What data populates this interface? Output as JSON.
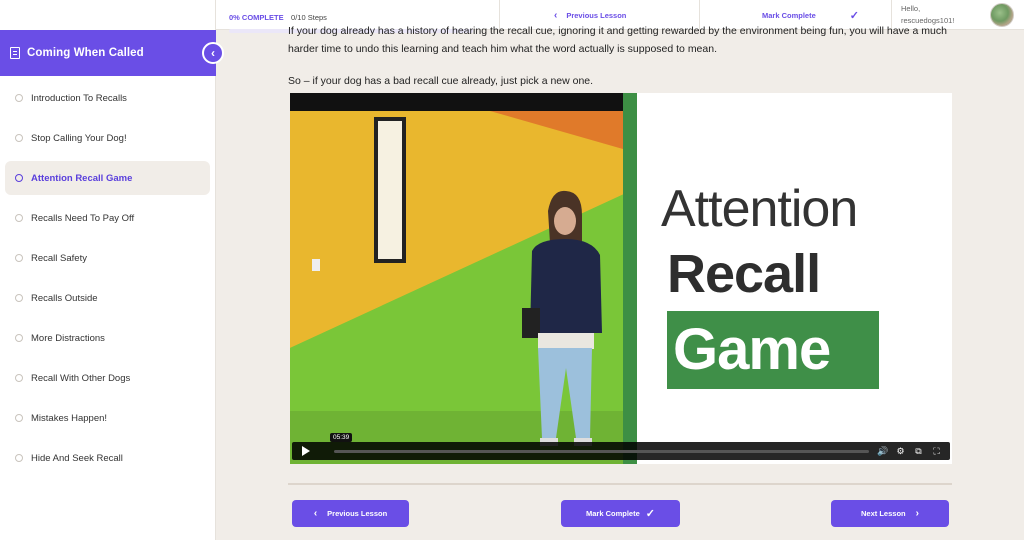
{
  "topbar": {
    "progress_percent": "0% COMPLETE",
    "progress_steps": "0/10 Steps",
    "progress_fraction": 0,
    "previous_label": "Previous Lesson",
    "mark_complete_label": "Mark Complete",
    "hello_line1": "Hello,",
    "hello_line2": "rescuedogs101!"
  },
  "sidebar": {
    "course_title": "Coming When Called",
    "lessons": [
      {
        "label": "Introduction To Recalls"
      },
      {
        "label": "Stop Calling Your Dog!"
      },
      {
        "label": "Attention Recall Game",
        "active": true
      },
      {
        "label": "Recalls Need To Pay Off"
      },
      {
        "label": "Recall Safety"
      },
      {
        "label": "Recalls Outside"
      },
      {
        "label": "More Distractions"
      },
      {
        "label": "Recall With Other Dogs"
      },
      {
        "label": "Mistakes Happen!"
      },
      {
        "label": "Hide And Seek Recall"
      }
    ]
  },
  "content": {
    "paragraph_partial": "If your dog already has a history of hearing the recall cue, ignoring it and getting rewarded by the environment being fun, you will have a much harder time to undo this learning and teach him what the word actually is supposed to mean.",
    "paragraph2": "So – if your dog has a bad recall cue already, just pick a new one.",
    "video": {
      "title_line1": "Attention",
      "title_line2": "Recall",
      "title_line3": "Game",
      "time_tooltip": "05:39"
    },
    "buttons": {
      "previous": "Previous Lesson",
      "mark_complete": "Mark Complete",
      "next": "Next Lesson"
    }
  },
  "colors": {
    "accent": "#6a4ee6",
    "background": "#f1ede8",
    "game_green": "#3f8f48"
  }
}
